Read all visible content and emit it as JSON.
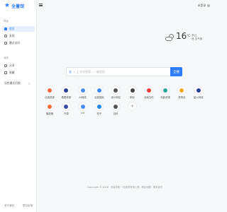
{
  "logo": {
    "text": "全量馆"
  },
  "sidebar": {
    "section1_title": "导航",
    "section1_items": [
      {
        "label": "首页",
        "icon": "home-icon",
        "active": true
      },
      {
        "label": "发现",
        "icon": "compass-icon",
        "active": false
      },
      {
        "label": "最近访问",
        "icon": "clock-icon",
        "active": false
      }
    ],
    "section2_title": "我的",
    "section2_items": [
      {
        "label": "分享",
        "icon": "share-icon"
      },
      {
        "label": "收藏",
        "icon": "star-icon"
      }
    ],
    "theme_label": "深色模式切换",
    "bottom_links": [
      "关于我们",
      "意见反馈"
    ]
  },
  "topbar": {
    "login": "未登录"
  },
  "weather": {
    "temp": "16",
    "unit": "°C",
    "line1": "多云",
    "line2": "良 空气良"
  },
  "search": {
    "engine": "全",
    "placeholder": "发现搜索...一键搜索",
    "button": "全搜"
  },
  "sites": [
    {
      "label": "动漫资源",
      "color": "#f26b3a"
    },
    {
      "label": "看看资源",
      "color": "#2c3e91"
    },
    {
      "label": "AI网络",
      "color": "#4a8cf0"
    },
    {
      "label": "百度搜索",
      "color": "#3d8cf5"
    },
    {
      "label": "设计网站",
      "color": "#555"
    },
    {
      "label": "精彩",
      "color": "#444"
    },
    {
      "label": "全局文件",
      "color": "#e53935"
    },
    {
      "label": "电影资源",
      "color": "#26a69a"
    },
    {
      "label": "表情包",
      "color": "#f5a623"
    },
    {
      "label": "星火网络",
      "color": "#2c3e91"
    },
    {
      "label": "播放器",
      "color": "#f26b3a"
    },
    {
      "label": "开源",
      "color": "#3949ab"
    },
    {
      "label": "UU",
      "color": "#4a8cf0"
    },
    {
      "label": "知乎",
      "color": "#1e88e5"
    },
    {
      "label": "百科",
      "color": "#555"
    },
    {
      "label": "",
      "color": "add"
    }
  ],
  "footer": {
    "text": "Copyright © 2018 · 全量导航·一站收录常用工具 · 网站地图 · 联系我们"
  }
}
